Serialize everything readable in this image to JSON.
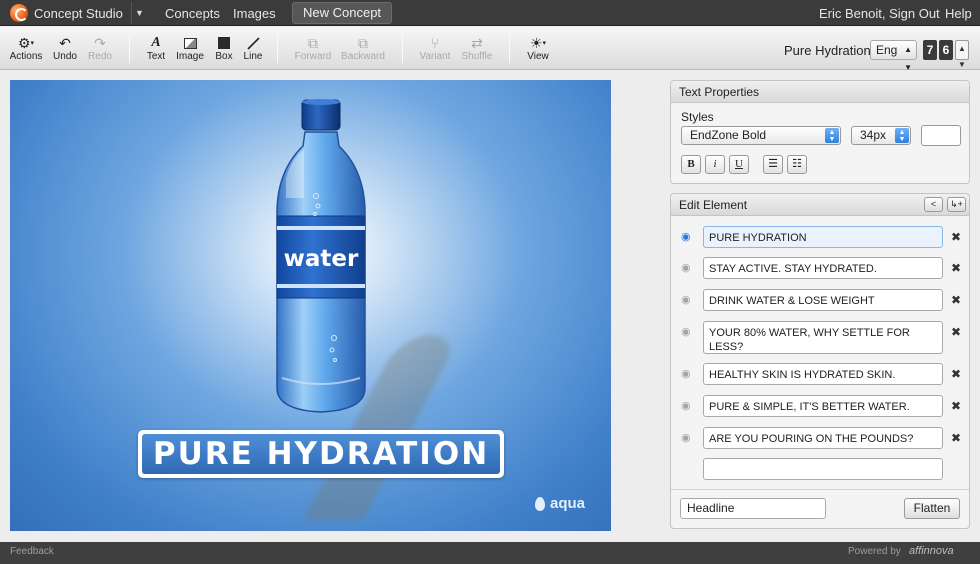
{
  "nav": {
    "brand": "Concept Studio",
    "links": [
      "Concepts",
      "Images"
    ],
    "new_concept": "New Concept",
    "user": "Eric Benoit, Sign Out",
    "help": "Help"
  },
  "toolbar": {
    "actions": "Actions",
    "undo": "Undo",
    "redo": "Redo",
    "text": "Text",
    "image": "Image",
    "box": "Box",
    "line": "Line",
    "forward": "Forward",
    "backward": "Backward",
    "variant": "Variant",
    "shuffle": "Shuffle",
    "view": "View",
    "project_name": "Pure Hydration",
    "language": "Eng",
    "counter_digits": [
      "7",
      "6"
    ]
  },
  "canvas": {
    "headline": "PURE HYDRATION",
    "bottle_label": "water",
    "brand_logo": "aqua",
    "background_color": "#3f7fc9"
  },
  "text_properties": {
    "title": "Text Properties",
    "styles_label": "Styles",
    "font": "EndZone Bold",
    "size": "34px",
    "format_buttons": [
      "B",
      "i",
      "U"
    ]
  },
  "edit_element": {
    "title": "Edit Element",
    "rows": [
      "PURE HYDRATION",
      "STAY ACTIVE. STAY HYDRATED.",
      "DRINK WATER & LOSE WEIGHT",
      "YOUR 80% WATER, WHY SETTLE FOR LESS?",
      "HEALTHY SKIN IS HYDRATED SKIN.",
      "PURE & SIMPLE, IT'S BETTER WATER.",
      "ARE YOU POURING ON THE POUNDS?",
      ""
    ],
    "element_type": "Headline",
    "flatten": "Flatten"
  },
  "footer": {
    "feedback": "Feedback",
    "powered_by": "Powered by",
    "vendor": "affinnova"
  }
}
